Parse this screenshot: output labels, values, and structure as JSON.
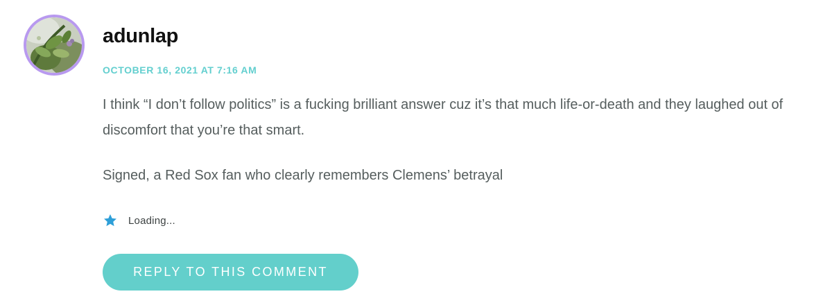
{
  "comment": {
    "author": "adunlap",
    "date": "OCTOBER 16, 2021 AT 7:16 AM",
    "paragraphs": [
      "I think “I don’t follow politics” is a fucking brilliant answer cuz it’s that much life-or-death and they laughed out of discomfort that you’re that smart.",
      "Signed, a Red Sox fan who clearly remembers Clemens’ betrayal"
    ],
    "likes": {
      "icon": "star-icon",
      "status": "Loading..."
    },
    "reply_label": "REPLY TO THIS COMMENT"
  },
  "colors": {
    "avatar_ring": "#b899ef",
    "date": "#63cfcf",
    "body_text": "#555d5d",
    "star": "#2e9fd8",
    "reply_button": "#63cfcb"
  }
}
